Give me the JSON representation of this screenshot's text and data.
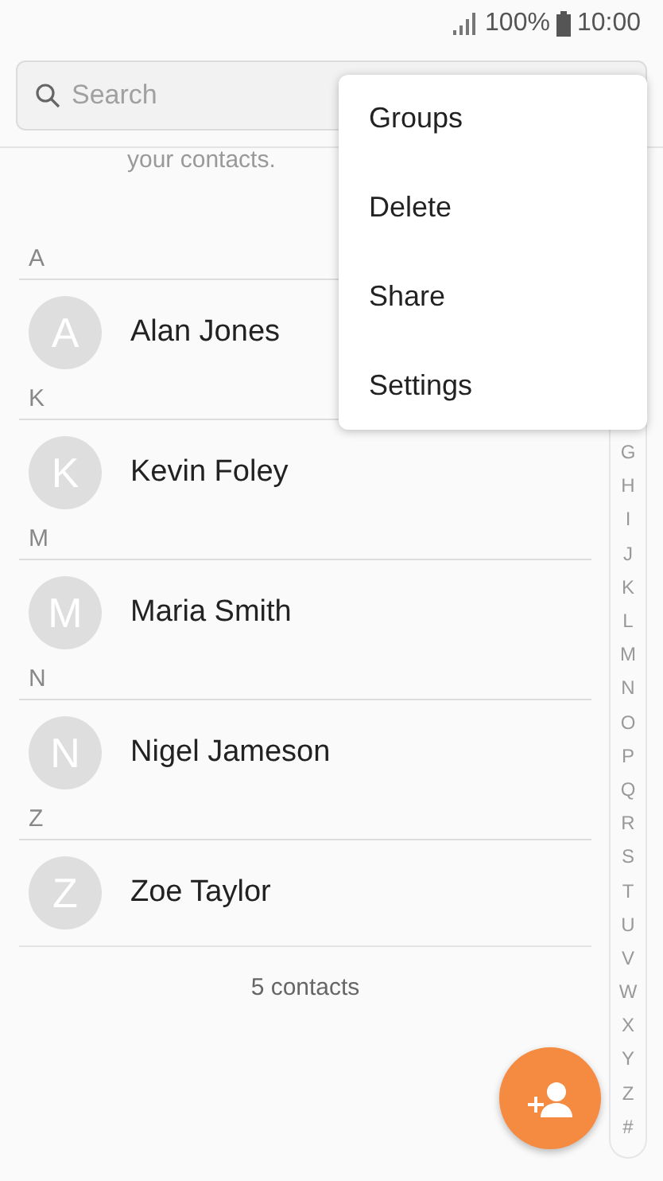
{
  "status_bar": {
    "battery": "100%",
    "time": "10:00"
  },
  "search": {
    "placeholder": "Search"
  },
  "hint_text": "your contacts.",
  "sections": [
    {
      "letter": "A",
      "contacts": [
        {
          "initial": "A",
          "name": "Alan Jones"
        }
      ]
    },
    {
      "letter": "K",
      "contacts": [
        {
          "initial": "K",
          "name": "Kevin Foley"
        }
      ]
    },
    {
      "letter": "M",
      "contacts": [
        {
          "initial": "M",
          "name": "Maria Smith"
        }
      ]
    },
    {
      "letter": "N",
      "contacts": [
        {
          "initial": "N",
          "name": "Nigel Jameson"
        }
      ]
    },
    {
      "letter": "Z",
      "contacts": [
        {
          "initial": "Z",
          "name": "Zoe Taylor"
        }
      ]
    }
  ],
  "contact_count": "5 contacts",
  "index_letters": [
    "G",
    "H",
    "I",
    "J",
    "K",
    "L",
    "M",
    "N",
    "O",
    "P",
    "Q",
    "R",
    "S",
    "T",
    "U",
    "V",
    "W",
    "X",
    "Y",
    "Z",
    "#"
  ],
  "menu": [
    "Groups",
    "Delete",
    "Share",
    "Settings"
  ]
}
